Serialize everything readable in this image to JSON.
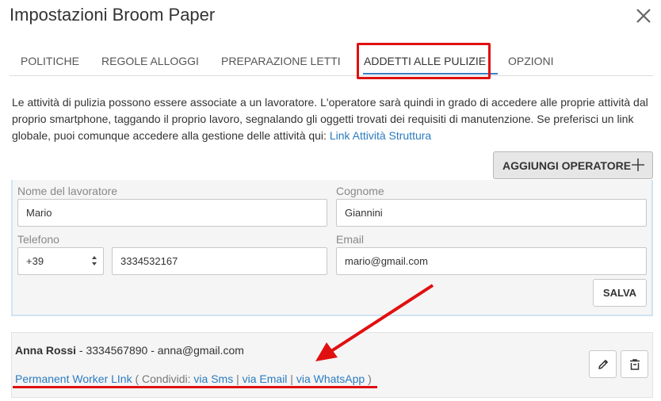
{
  "dialog": {
    "title": "Impostazioni Broom Paper"
  },
  "tabs": [
    {
      "label": "POLITICHE",
      "active": false
    },
    {
      "label": "REGOLE ALLOGGI",
      "active": false
    },
    {
      "label": "PREPARAZIONE LETTI",
      "active": false
    },
    {
      "label": "ADDETTI ALLE PULIZIE",
      "active": true
    },
    {
      "label": "OPZIONI",
      "active": false
    }
  ],
  "description": {
    "text": "Le attività di pulizia possono essere associate a un lavoratore. L'operatore sarà quindi in grado di accedere alle proprie attività dal proprio smartphone, taggando il proprio lavoro, segnalando gli oggetti trovati dei requisiti di manutenzione. Se preferisci un link globale, puoi comunque accedere alla gestione delle attività qui:",
    "link_label": "Link Attività Struttura"
  },
  "add_operator_button": "AGGIUNGI OPERATORE",
  "form": {
    "first_name_label": "Nome del lavoratore",
    "first_name_value": "Mario",
    "last_name_label": "Cognome",
    "last_name_value": "Giannini",
    "phone_label": "Telefono",
    "phone_prefix": "+39",
    "phone_value": "3334532167",
    "email_label": "Email",
    "email_value": "mario@gmail.com",
    "save_button": "SALVA"
  },
  "worker": {
    "name": "Anna Rossi",
    "details": " - 3334567890 - anna@gmail.com",
    "permanent_link": "Permanent Worker LInk",
    "share_open": " ( Condividi: ",
    "via_sms": "via Sms",
    "via_email": "via Email",
    "via_whatsapp": "via WhatsApp",
    "sep": " | ",
    "share_close": " )"
  },
  "colors": {
    "accent": "#2a7bc0",
    "annotation": "#e01010",
    "panel_bg": "#f5f5f5"
  },
  "icons": [
    "close-icon",
    "plus-icon",
    "select-arrows-icon",
    "pencil-icon",
    "trash-icon",
    "arrow-annotation"
  ]
}
